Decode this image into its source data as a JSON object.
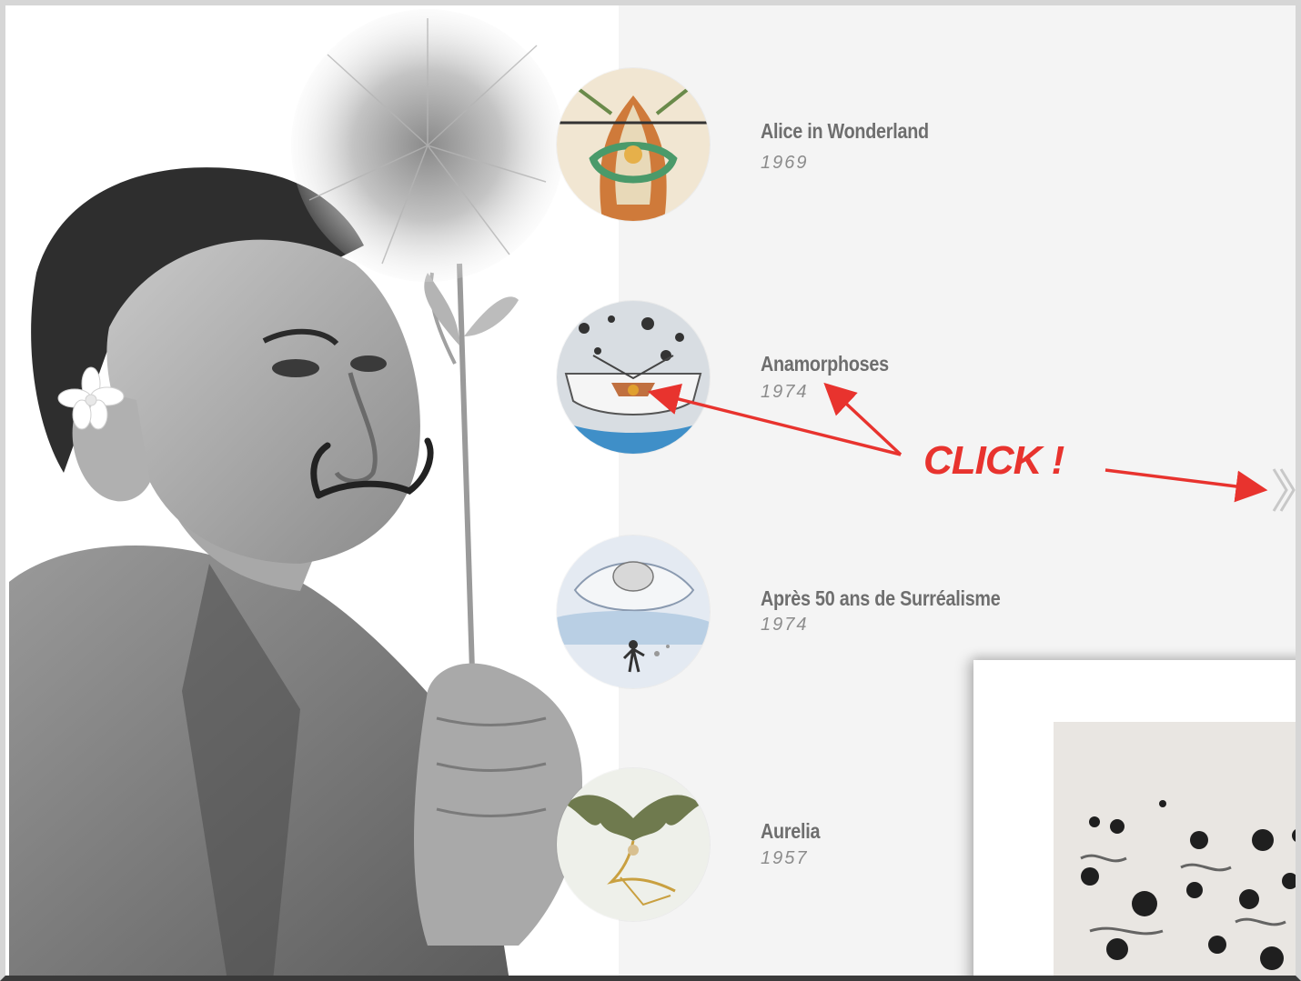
{
  "series_list": [
    {
      "title": "Alice in Wonderland",
      "year": "1969",
      "thumbnail_icon": "alice-artwork-thumbnail"
    },
    {
      "title": "Anamorphoses",
      "year": "1974",
      "thumbnail_icon": "anamorphoses-artwork-thumbnail"
    },
    {
      "title": "Après 50 ans de Surréalisme",
      "year": "1974",
      "thumbnail_icon": "surrealisme-artwork-thumbnail"
    },
    {
      "title": "Aurelia",
      "year": "1957",
      "thumbnail_icon": "aurelia-artwork-thumbnail"
    }
  ],
  "annotation": {
    "label": "CLICK !",
    "color": "#e8332e"
  },
  "navigation": {
    "next_icon": "chevron-right-icon"
  },
  "colors": {
    "panel_background": "#f4f4f4",
    "title_text": "#6e6e6e",
    "year_text": "#8c8c8c"
  }
}
